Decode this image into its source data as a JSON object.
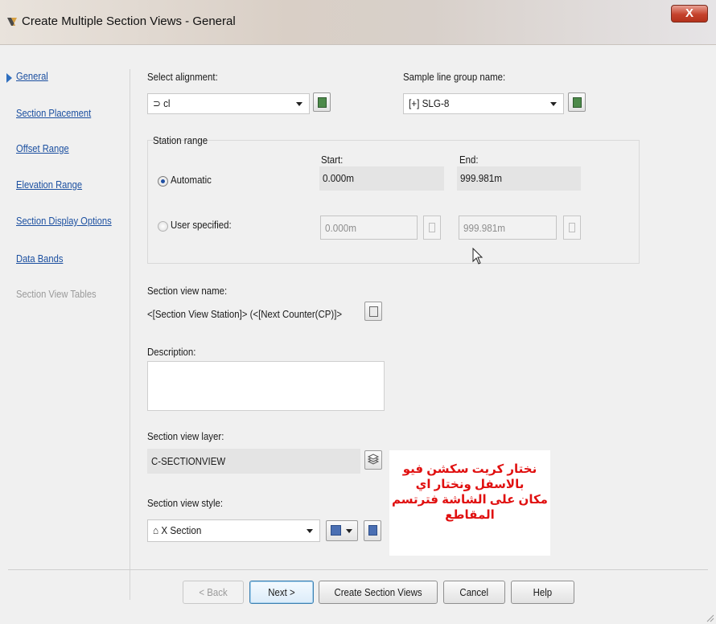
{
  "window": {
    "title": "Create Multiple Section Views - General",
    "close_label": "X"
  },
  "nav": {
    "items": [
      {
        "label": "General",
        "active": true,
        "enabled": true
      },
      {
        "label": "Section Placement",
        "active": false,
        "enabled": true
      },
      {
        "label": "Offset Range",
        "active": false,
        "enabled": true
      },
      {
        "label": "Elevation Range",
        "active": false,
        "enabled": true
      },
      {
        "label": "Section Display Options",
        "active": false,
        "enabled": true
      },
      {
        "label": "Data Bands",
        "active": false,
        "enabled": true
      },
      {
        "label": "Section View Tables",
        "active": false,
        "enabled": false
      }
    ]
  },
  "alignment": {
    "label": "Select alignment:",
    "value": "cl",
    "icon": "alignment-icon"
  },
  "sample_line_group": {
    "label": "Sample line group name:",
    "value": "SLG-8",
    "icon": "sample-line-group-icon"
  },
  "station_range": {
    "title": "Station range",
    "start_label": "Start:",
    "end_label": "End:",
    "automatic": {
      "label": "Automatic",
      "selected": true,
      "start": "0.000m",
      "end": "999.981m"
    },
    "user_specified": {
      "label": "User specified:",
      "selected": false,
      "start": "0.000m",
      "end": "999.981m"
    }
  },
  "section_view_name": {
    "label": "Section view name:",
    "value": "<[Section View Station]> (<[Next Counter(CP)]>"
  },
  "description": {
    "label": "Description:",
    "value": ""
  },
  "section_view_layer": {
    "label": "Section view layer:",
    "value": "C-SECTIONVIEW"
  },
  "section_view_style": {
    "label": "Section view style:",
    "value": "X Section"
  },
  "annotation": {
    "lines": [
      "نختار كريت سكشن فيو",
      "بالاسفل   ونختار اي",
      "مكان على الشاشة فترتسم",
      "المقاطع"
    ],
    "color": "#e01010"
  },
  "buttons": {
    "back": "< Back",
    "next": "Next >",
    "create": "Create Section Views",
    "cancel": "Cancel",
    "help": "Help"
  },
  "colors": {
    "link": "#1b4fa0",
    "close_button": "#c5422c",
    "annotation_text": "#e01010"
  }
}
